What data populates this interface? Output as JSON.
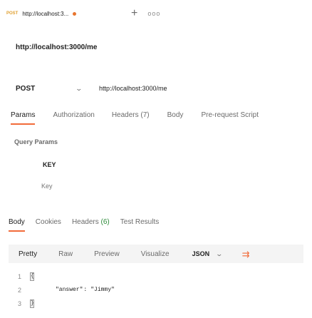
{
  "tab": {
    "method": "POST",
    "url": "http://localhost:3...",
    "add_label": "+",
    "more_label": "ooo"
  },
  "request": {
    "title": "http://localhost:3000/me",
    "method": "POST",
    "url": "http://localhost:3000/me"
  },
  "request_tabs": [
    {
      "label": "Params",
      "active": true
    },
    {
      "label": "Authorization"
    },
    {
      "label": "Headers (7)"
    },
    {
      "label": "Body"
    },
    {
      "label": "Pre-request Script"
    }
  ],
  "params": {
    "section_label": "Query Params",
    "key_header": "KEY",
    "key_placeholder": "Key"
  },
  "response_tabs": {
    "body": "Body",
    "cookies": "Cookies",
    "headers_label": "Headers",
    "headers_count": "(6)",
    "test_results": "Test Results"
  },
  "view_options": {
    "pretty": "Pretty",
    "raw": "Raw",
    "preview": "Preview",
    "visualize": "Visualize",
    "format": "JSON"
  },
  "response_body": {
    "line_numbers": [
      "1",
      "2",
      "3"
    ],
    "key": "\"answer\"",
    "separator": ":",
    "value": "\"Jimmy\""
  },
  "colors": {
    "accent": "#f26b3a",
    "method_tab": "#e0a030",
    "unsaved_dot": "#e8752e",
    "count_green": "#2e8b3a"
  }
}
